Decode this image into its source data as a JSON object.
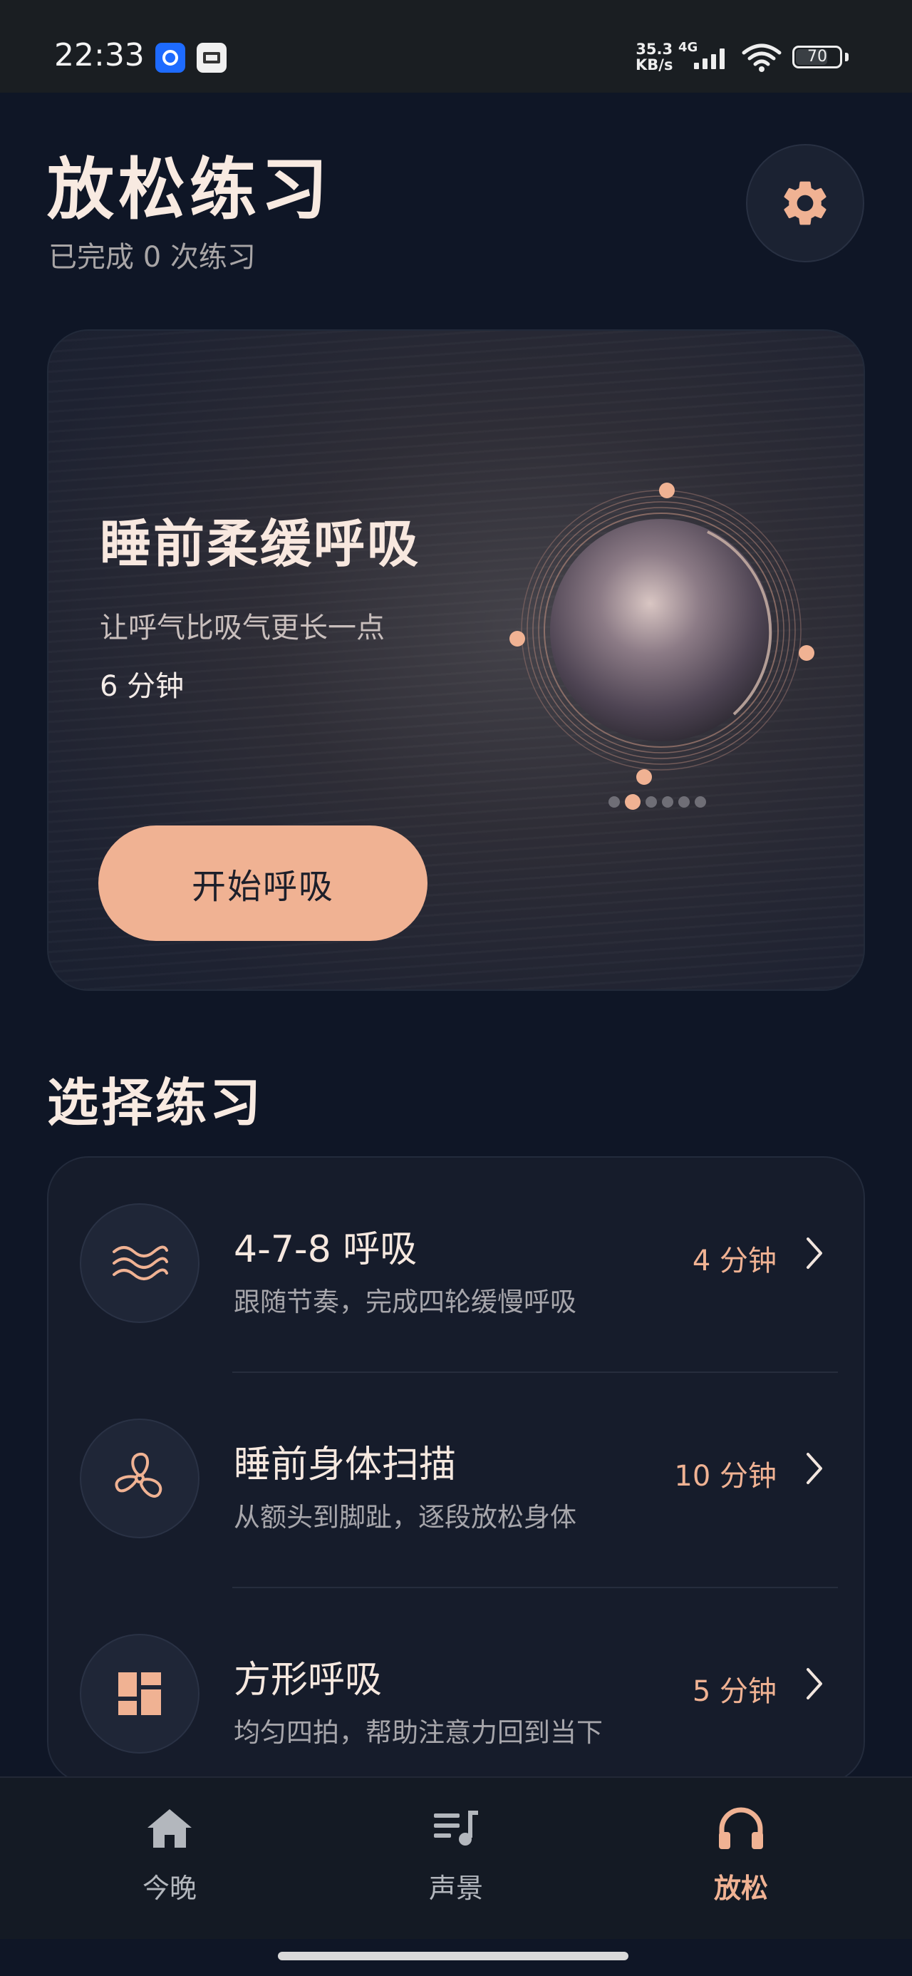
{
  "status_bar": {
    "time": "22:33",
    "net_speed_value": "35.3",
    "net_speed_unit": "KB/s",
    "net_type": "4G",
    "battery": "70",
    "app_icons": [
      "chat-app-icon",
      "media-app-icon"
    ]
  },
  "header": {
    "title": "放松练习",
    "subtitle": "已完成 0 次练习",
    "settings_icon": "gear-icon"
  },
  "hero": {
    "title": "睡前柔缓呼吸",
    "description": "让呼气比吸气更长一点",
    "duration": "6 分钟",
    "start_label": "开始呼吸",
    "carousel_total": 6,
    "carousel_active_index": 1
  },
  "section": {
    "title": "选择练习"
  },
  "exercises": [
    {
      "title": "4-7-8 呼吸",
      "subtitle": "跟随节奏，完成四轮缓慢呼吸",
      "duration": "4 分钟",
      "icon": "waves-icon"
    },
    {
      "title": "睡前身体扫描",
      "subtitle": "从额头到脚趾，逐段放松身体",
      "duration": "10 分钟",
      "icon": "fan-icon"
    },
    {
      "title": "方形呼吸",
      "subtitle": "均匀四拍，帮助注意力回到当下",
      "duration": "5 分钟",
      "icon": "grid-icon"
    }
  ],
  "bottom_nav": {
    "items": [
      {
        "label": "今晚",
        "icon": "home-icon"
      },
      {
        "label": "声景",
        "icon": "playlist-icon"
      },
      {
        "label": "放松",
        "icon": "headphones-icon"
      }
    ],
    "active": "放松"
  },
  "colors": {
    "accent": "#f0b293",
    "background": "#0f1626",
    "card": "#161c2b"
  }
}
